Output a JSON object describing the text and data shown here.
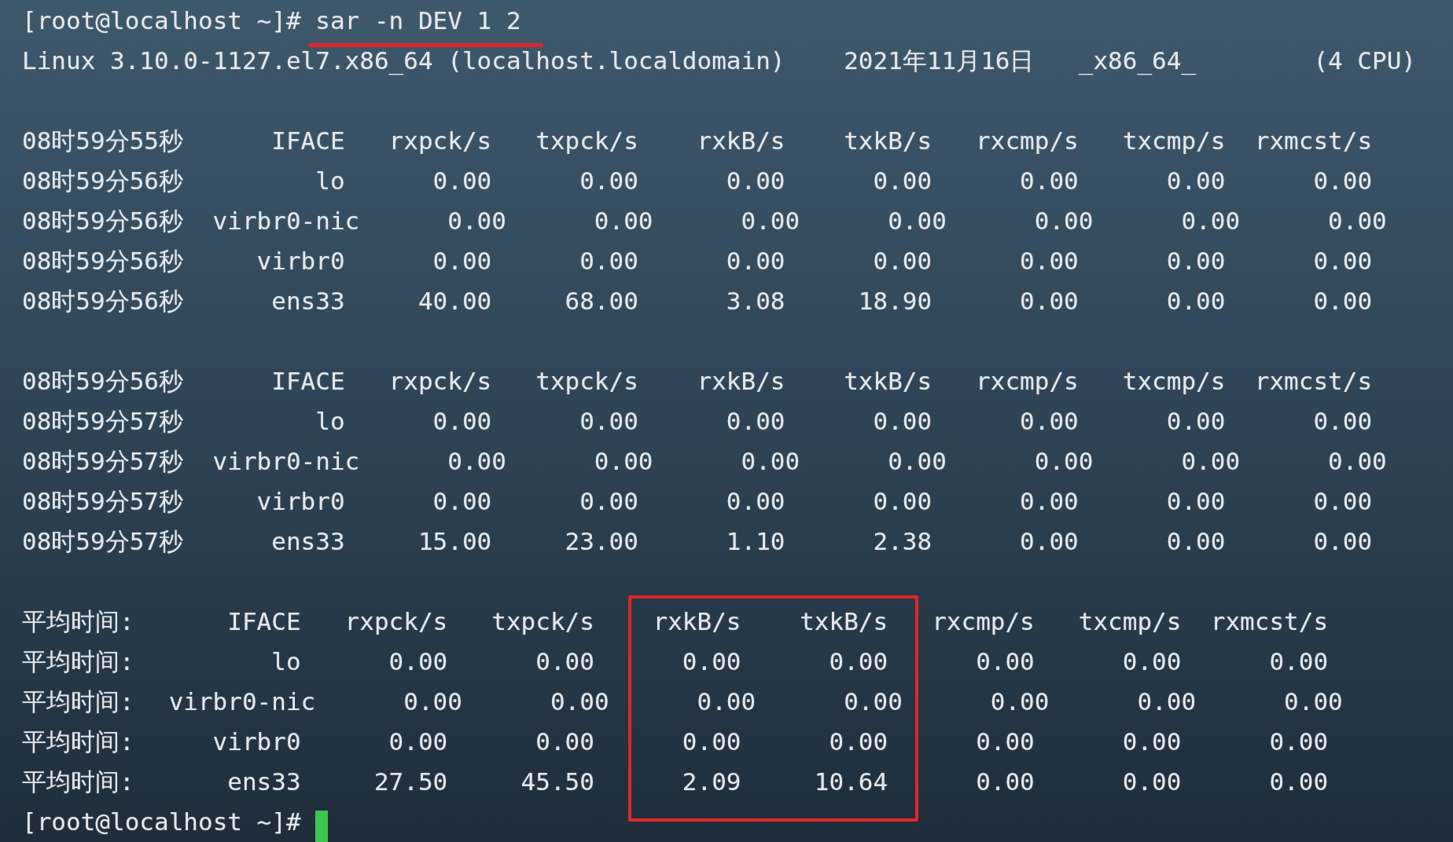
{
  "command_line": {
    "prompt": "[root@localhost ~]#",
    "command": "sar -n DEV 1 2",
    "underlined": true
  },
  "system_line": {
    "kernel": "Linux 3.10.0-1127.el7.x86_64 (localhost.localdomain)",
    "date": "2021年11月16日",
    "arch": "_x86_64_",
    "cpus": "(4 CPU)"
  },
  "blocks": [
    {
      "kind": "timestamp",
      "boxed": false,
      "lines": [
        {
          "time": "08时59分55秒",
          "text": "     IFACE   rxpck/s   txpck/s    rxkB/s    txkB/s   rxcmp/s   txcmp/s  rxmcst/s"
        },
        {
          "time": "08时59分56秒",
          "text": "        lo      0.00      0.00      0.00      0.00      0.00      0.00      0.00"
        },
        {
          "time": "08时59分56秒",
          "text": " virbr0-nic      0.00      0.00      0.00      0.00      0.00      0.00      0.00"
        },
        {
          "time": "08时59分56秒",
          "text": "    virbr0      0.00      0.00      0.00      0.00      0.00      0.00      0.00"
        },
        {
          "time": "08时59分56秒",
          "text": "     ens33     40.00     68.00      3.08     18.90      0.00      0.00      0.00"
        }
      ]
    },
    {
      "kind": "timestamp",
      "boxed": false,
      "lines": [
        {
          "time": "08时59分56秒",
          "text": "     IFACE   rxpck/s   txpck/s    rxkB/s    txkB/s   rxcmp/s   txcmp/s  rxmcst/s"
        },
        {
          "time": "08时59分57秒",
          "text": "        lo      0.00      0.00      0.00      0.00      0.00      0.00      0.00"
        },
        {
          "time": "08时59分57秒",
          "text": " virbr0-nic      0.00      0.00      0.00      0.00      0.00      0.00      0.00"
        },
        {
          "time": "08时59分57秒",
          "text": "    virbr0      0.00      0.00      0.00      0.00      0.00      0.00      0.00"
        },
        {
          "time": "08时59分57秒",
          "text": "     ens33     15.00     23.00      1.10      2.38      0.00      0.00      0.00"
        }
      ]
    },
    {
      "kind": "average",
      "boxed": true,
      "lines": [
        {
          "time": "平均时间:",
          "text": "     IFACE   rxpck/s   txpck/s    rxkB/s    txkB/s   rxcmp/s   txcmp/s  rxmcst/s"
        },
        {
          "time": "平均时间:",
          "text": "        lo      0.00      0.00      0.00      0.00      0.00      0.00      0.00"
        },
        {
          "time": "平均时间:",
          "text": " virbr0-nic      0.00      0.00      0.00      0.00      0.00      0.00      0.00"
        },
        {
          "time": "平均时间:",
          "text": "    virbr0      0.00      0.00      0.00      0.00      0.00      0.00      0.00"
        },
        {
          "time": "平均时间:",
          "text": "     ens33     27.50     45.50      2.09     10.64      0.00      0.00      0.00"
        }
      ]
    }
  ],
  "final_prompt": {
    "prompt": "[root@localhost ~]#",
    "cursor": true
  }
}
